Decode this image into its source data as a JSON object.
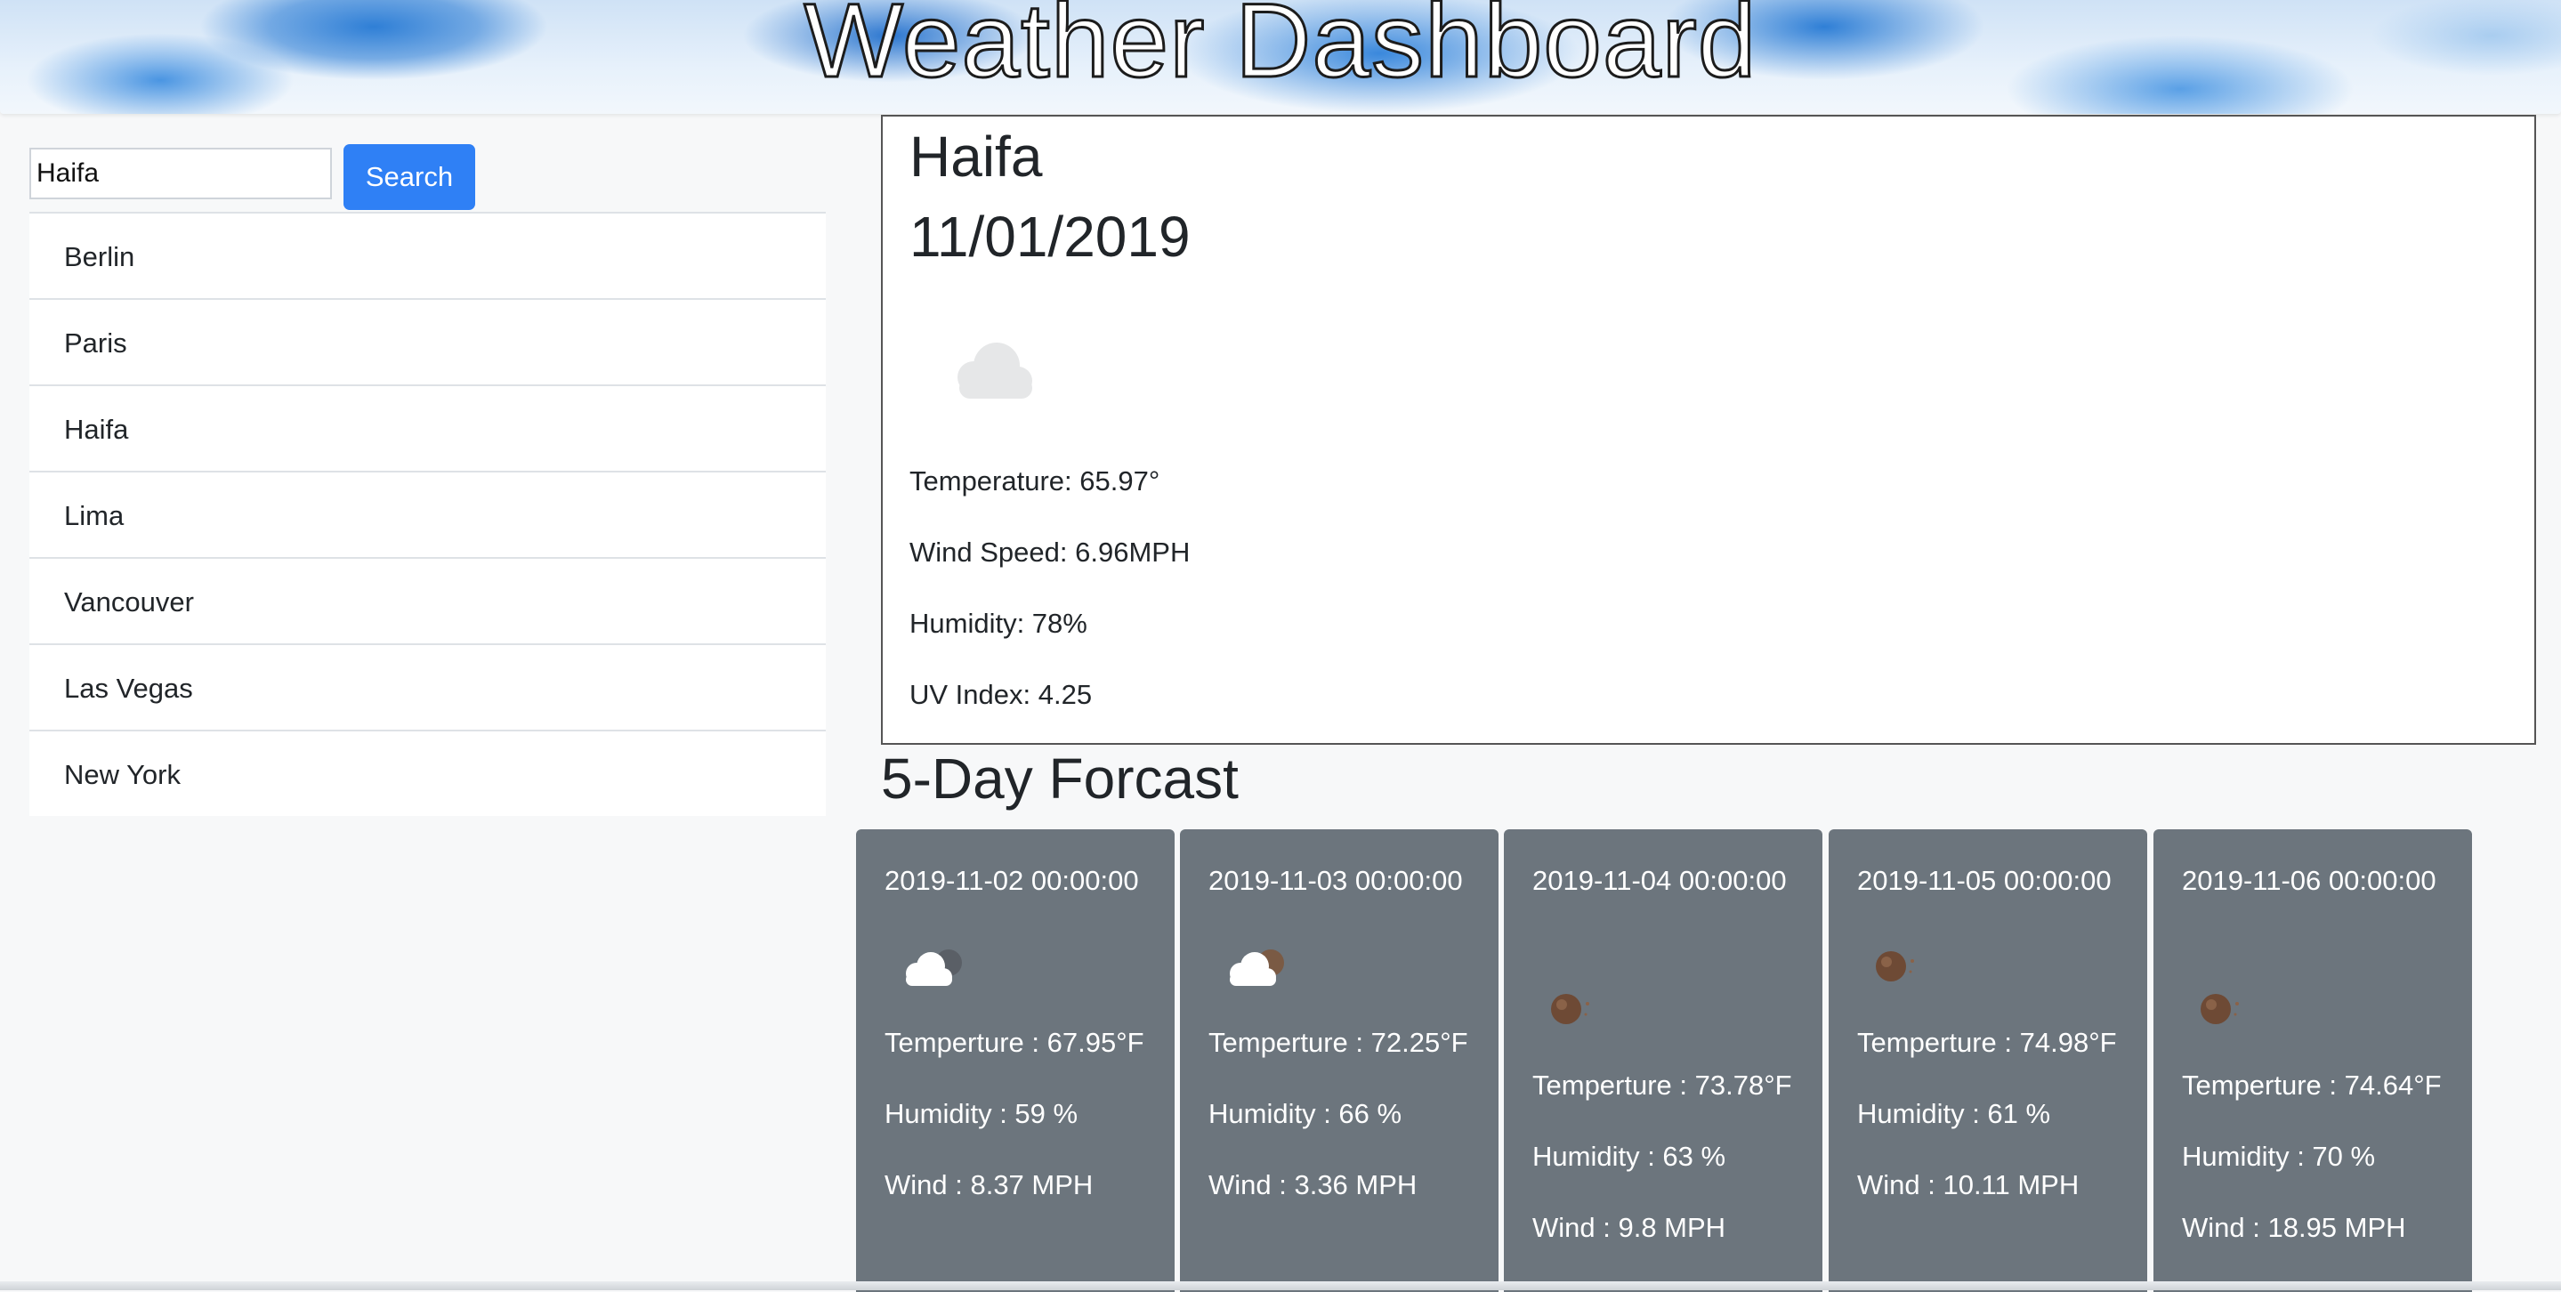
{
  "header": {
    "title": "Weather Dashboard"
  },
  "search": {
    "value": "Haifa",
    "button_label": "Search"
  },
  "cities": [
    "Berlin",
    "Paris",
    "Haifa",
    "Lima",
    "Vancouver",
    "Las Vegas",
    "New York"
  ],
  "current": {
    "city": "Haifa",
    "date": "11/01/2019",
    "icon": "cloud-icon",
    "temperature": "Temperature: 65.97°",
    "wind": "Wind Speed: 6.96MPH",
    "humidity": "Humidity: 78%",
    "uv": "UV Index: 4.25"
  },
  "forecast": {
    "title": "5-Day Forcast",
    "days": [
      {
        "date": "2019-11-02 00:00:00",
        "icon": "partly-cloudy-night-icon",
        "temp": "Temperture : 67.95°F",
        "humidity": "Humidity : 59 %",
        "wind": "Wind : 8.37 MPH"
      },
      {
        "date": "2019-11-03 00:00:00",
        "icon": "partly-cloudy-night-icon",
        "temp": "Temperture : 72.25°F",
        "humidity": "Humidity : 66 %",
        "wind": "Wind : 3.36 MPH"
      },
      {
        "date": "2019-11-04 00:00:00",
        "icon": "clear-night-icon",
        "temp": "Temperture : 73.78°F",
        "humidity": "Humidity : 63 %",
        "wind": "Wind : 9.8 MPH"
      },
      {
        "date": "2019-11-05 00:00:00",
        "icon": "clear-night-icon",
        "temp": "Temperture : 74.98°F",
        "humidity": "Humidity : 61 %",
        "wind": "Wind : 10.11 MPH"
      },
      {
        "date": "2019-11-06 00:00:00",
        "icon": "clear-night-icon",
        "temp": "Temperture : 74.64°F",
        "humidity": "Humidity : 70 %",
        "wind": "Wind : 18.95 MPH"
      }
    ]
  },
  "colors": {
    "search_button": "#2f80f5",
    "card_bg": "#6c757d"
  }
}
